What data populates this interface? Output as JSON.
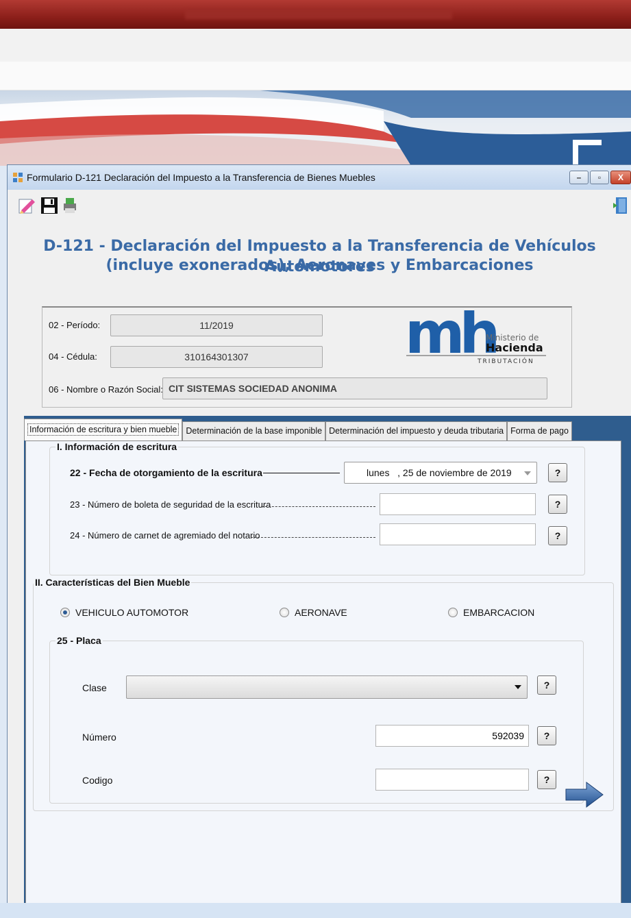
{
  "window": {
    "title": "Formulario D-121 Declaración del Impuesto a la Transferencia de Bienes Muebles",
    "controls": {
      "minimize": "–",
      "maximize": "▫",
      "close": "X"
    }
  },
  "toolbar": {
    "icons": [
      "edit-icon",
      "save-icon",
      "print-icon",
      "exit-door-icon"
    ]
  },
  "heading": {
    "line1": "D-121 - Declaración del Impuesto a la Transferencia de Vehículos Automotores",
    "line2": "(incluye exonerados), Aeronaves y Embarcaciones"
  },
  "header": {
    "periodo_label": "02 - Período:",
    "periodo_value": "11/2019",
    "cedula_label": "04 - Cédula:",
    "cedula_value": "310164301307",
    "nombre_label": "06 - Nombre o Razón Social:",
    "nombre_value": "CIT SISTEMAS SOCIEDAD ANONIMA"
  },
  "logo": {
    "letters": "mh",
    "line1": "Ministerio de",
    "line2": "Hacienda",
    "line3": "TRIBUTACIÓN",
    "color": "#1f5fa8"
  },
  "tabs": [
    {
      "label": "Información de escritura y bien mueble",
      "active": true
    },
    {
      "label": "Determinación de la base imponible",
      "active": false
    },
    {
      "label": "Determinación del impuesto y deuda tributaria",
      "active": false
    },
    {
      "label": "Forma de pago",
      "active": false
    }
  ],
  "section1": {
    "legend": "I. Información de escritura",
    "field22_label": "22 - Fecha de otorgamiento de la escritura",
    "field22_value": "lunes   , 25 de noviembre de 2019",
    "field23_label": "23 - Número de boleta de seguridad de la escritura",
    "field23_value": "",
    "field24_label": "24 - Número de carnet de agremiado del notario",
    "field24_value": ""
  },
  "section2": {
    "legend": "II. Características del Bien Mueble",
    "radios": [
      {
        "label": "VEHICULO AUTOMOTOR",
        "checked": true
      },
      {
        "label": "AERONAVE",
        "checked": false
      },
      {
        "label": "EMBARCACION",
        "checked": false
      }
    ],
    "placa": {
      "legend": "25 - Placa",
      "clase_label": "Clase",
      "clase_value": "",
      "numero_label": "Número",
      "numero_value": "592039",
      "codigo_label": "Codigo",
      "codigo_value": ""
    }
  },
  "help_button": "?",
  "colors": {
    "heading": "#3a6aa6",
    "tab_frame": "#2f5d8e",
    "window_frame": "#c6d9ef"
  }
}
